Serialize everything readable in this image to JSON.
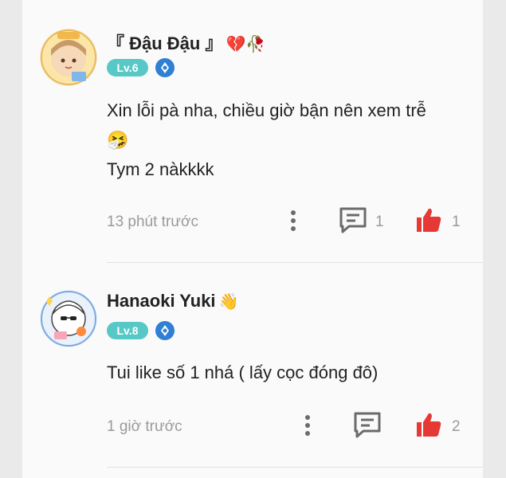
{
  "comments": [
    {
      "username": "『 Đậu Đậu 』",
      "name_emoji": "💔🥀",
      "level": "Lv.6",
      "text_line1": "Xin lỗi pà nha, chiều giờ bận nên xem trễ",
      "text_emoji": "🤧",
      "text_line2": "Tym 2 nàkkkk",
      "time": "13 phút trước",
      "reply_count": "1",
      "like_count": "1"
    },
    {
      "username": "Hanaoki Yuki",
      "name_emoji": "👋",
      "level": "Lv.8",
      "text_line1": "Tui like số 1 nhá ( lấy cọc đóng đô)",
      "time": "1 giờ trước",
      "like_count": "2"
    }
  ],
  "colors": {
    "level_badge": "#58c8c6",
    "like_heart": "#e53935",
    "icon_gray": "#6b6b6b",
    "background": "#fafafa"
  }
}
